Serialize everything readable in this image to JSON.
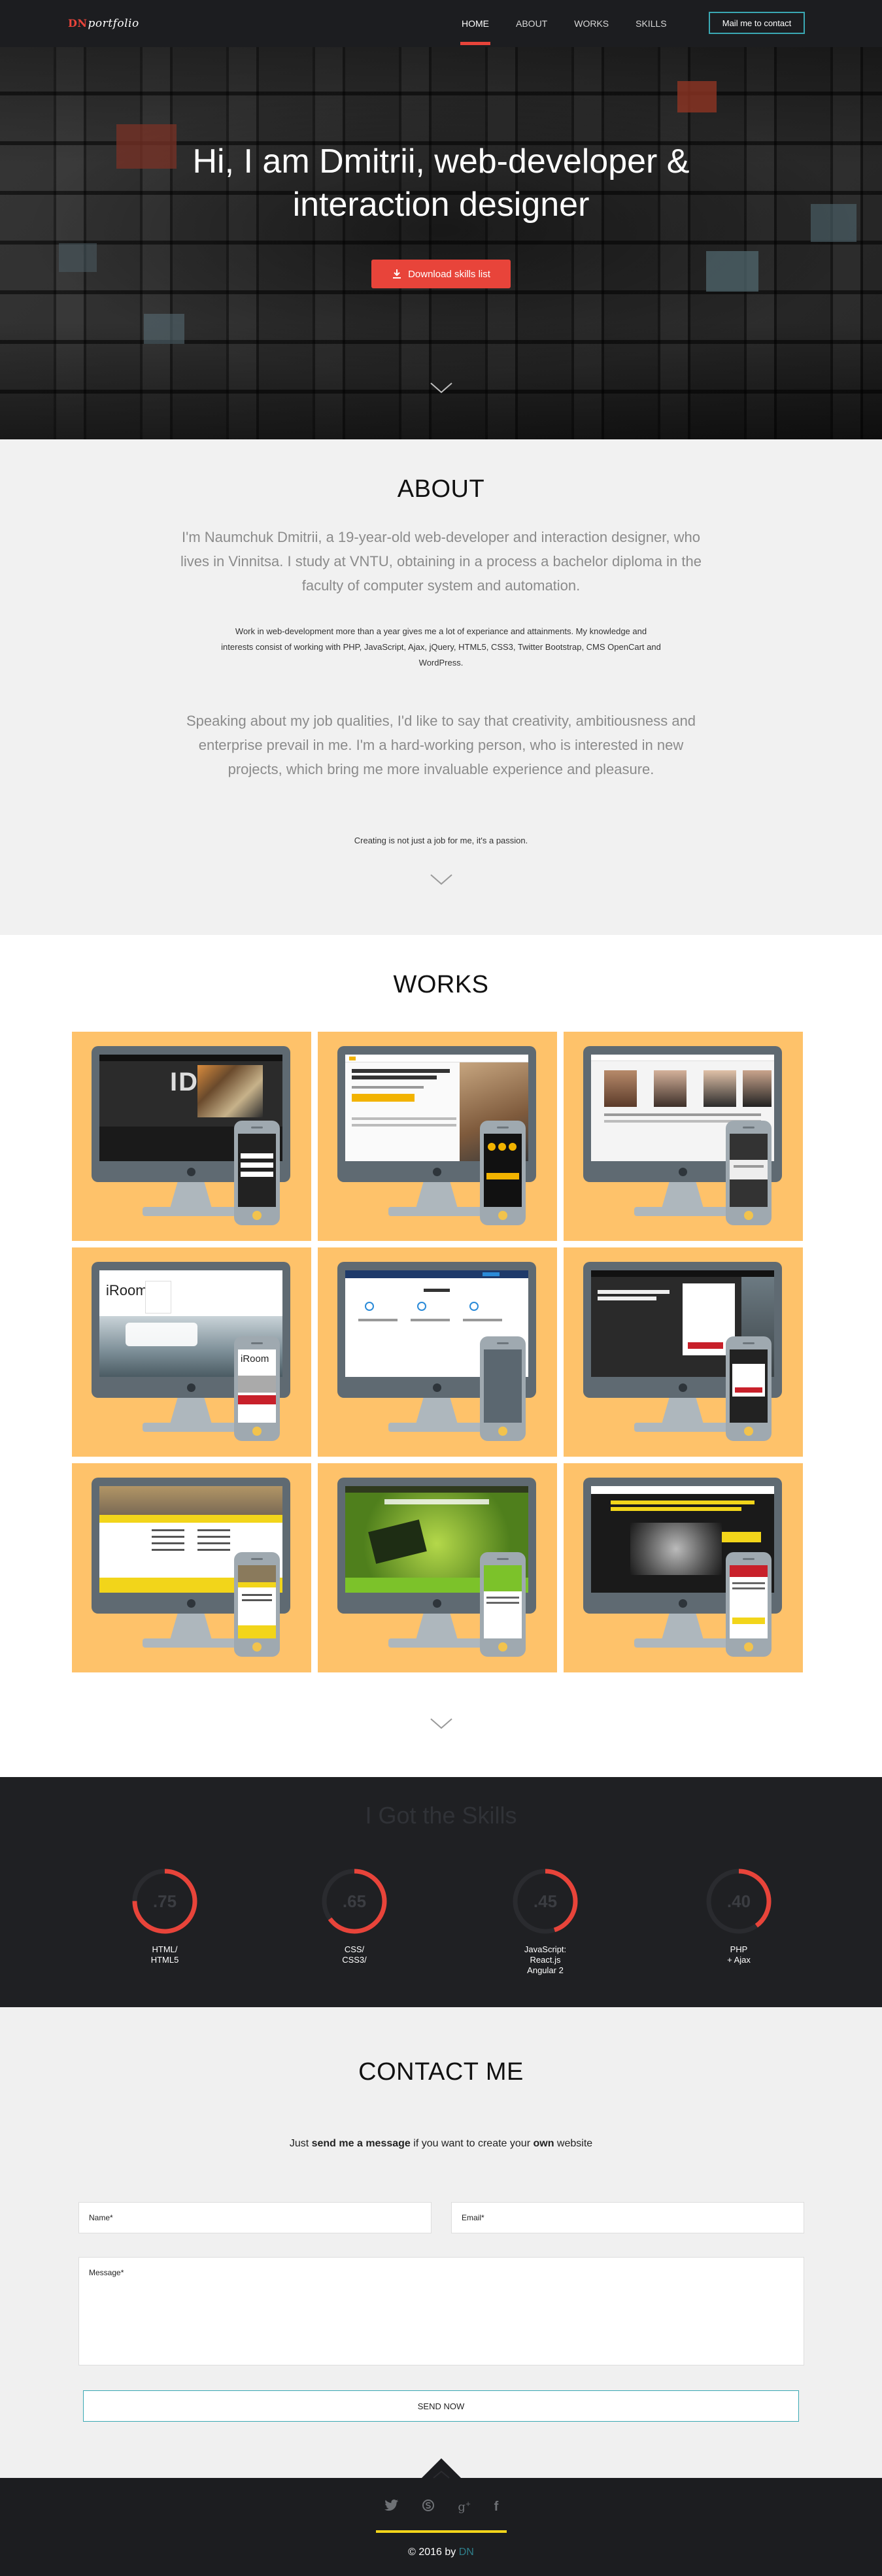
{
  "nav": {
    "logo_prefix": "DN",
    "logo_text": "portfolio",
    "items": [
      {
        "label": "HOME",
        "active": true
      },
      {
        "label": "ABOUT",
        "active": false
      },
      {
        "label": "WORKS",
        "active": false
      },
      {
        "label": "SKILLS",
        "active": false
      }
    ],
    "mail_button": "Mail me to contact"
  },
  "hero": {
    "title_line1": "Hi, I am Dmitrii, web-developer &",
    "title_line2": "interaction designer",
    "download_button": "Download skills list",
    "download_icon": "download-icon",
    "scroll_icon": "chevron-down-icon"
  },
  "about": {
    "title": "ABOUT",
    "p1_l1": "I'm Naumchuk Dmitrii, a 19-year-old web-developer and interaction designer, who",
    "p1_l2": "lives in Vinnitsa. I study at VNTU, obtaining in a process a bachelor diploma in the",
    "p1_l3": "faculty of computer system and automation.",
    "p2_l1": "Work in web-development more than a year gives me a lot of experiance and attainments. My knowledge and",
    "p2_l2": "interests consist of working with PHP, JavaScript, Ajax, jQuery, HTML5, CSS3, Twitter Bootstrap, CMS OpenCart and",
    "p2_l3": "WordPress.",
    "p3_l1": "Speaking about my job qualities, I'd like to say that creativity, ambitiousness and",
    "p3_l2": "enterprise prevail in me. I'm a hard-working person, who is interested in new",
    "p3_l3": "projects, which bring me more invaluable experience and pleasure.",
    "tagline": "Creating is not just a job for me, it's a passion."
  },
  "works": {
    "title": "WORKS",
    "items": [
      {
        "name": "work-idea",
        "screen_theme": "dark",
        "headline": "IDEA"
      },
      {
        "name": "work-fuel",
        "screen_theme": "light",
        "headline": ""
      },
      {
        "name": "work-people",
        "screen_theme": "light",
        "headline": ""
      },
      {
        "name": "work-iroom-drone",
        "screen_theme": "light",
        "headline": "iRoom"
      },
      {
        "name": "work-services",
        "screen_theme": "light",
        "headline": ""
      },
      {
        "name": "work-rent",
        "screen_theme": "dark",
        "headline": ""
      },
      {
        "name": "work-schedule",
        "screen_theme": "yellow",
        "headline": ""
      },
      {
        "name": "work-green",
        "screen_theme": "green",
        "headline": ""
      },
      {
        "name": "work-engines",
        "screen_theme": "dark",
        "headline": ""
      }
    ],
    "phone_iroom": "iRoom"
  },
  "skills": {
    "title": "I Got the Skills",
    "accent_color": "#e8443a",
    "items": [
      {
        "value": ".75",
        "percent": 75,
        "label_l1": "HTML/",
        "label_l2": "HTML5",
        "label_l3": ""
      },
      {
        "value": ".65",
        "percent": 65,
        "label_l1": "CSS/",
        "label_l2": "CSS3/",
        "label_l3": ""
      },
      {
        "value": ".45",
        "percent": 45,
        "label_l1": "JavaScript:",
        "label_l2": "React.js",
        "label_l3": "Angular 2"
      },
      {
        "value": ".40",
        "percent": 40,
        "label_l1": "PHP",
        "label_l2": "+ Ajax",
        "label_l3": ""
      }
    ]
  },
  "contact": {
    "title": "CONTACT ME",
    "lead_a": "Just ",
    "lead_b": "send me a message",
    "lead_c": " if you want to create your ",
    "lead_d": "own",
    "lead_e": " website",
    "name_placeholder": "Name*",
    "email_placeholder": "Email*",
    "message_placeholder": "Message*",
    "send_button": "SEND NOW"
  },
  "footer": {
    "socials": [
      "twitter-icon",
      "skype-icon",
      "google-plus-icon",
      "facebook-icon"
    ],
    "copyright": "© 2016 by ",
    "author": "DN"
  }
}
